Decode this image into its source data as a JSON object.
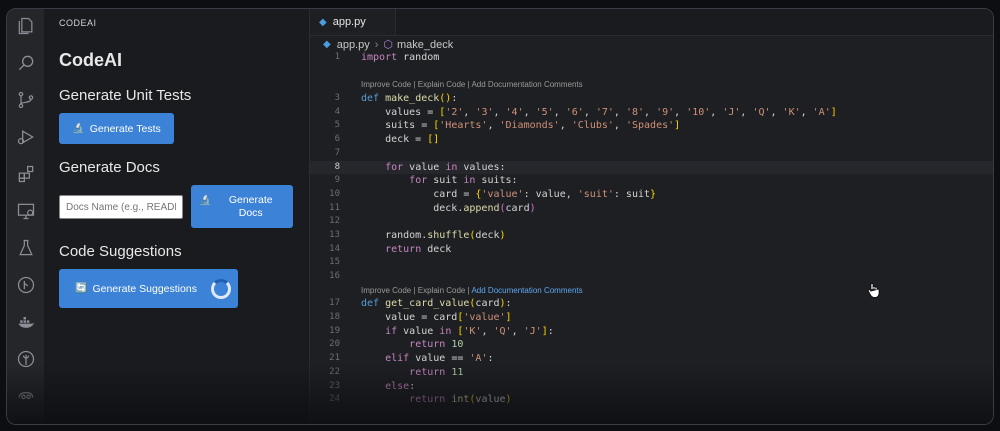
{
  "panel": {
    "title": "CODEAI",
    "heading": "CodeAI",
    "unit_tests_heading": "Generate Unit Tests",
    "generate_tests_label": "Generate Tests",
    "docs_heading": "Generate Docs",
    "docs_placeholder": "Docs Name (e.g., README.md)",
    "generate_docs_label": "Generate Docs",
    "suggestions_heading": "Code Suggestions",
    "generate_suggestions_label": "Generate Suggestions"
  },
  "activity_bar": [
    "explorer-icon",
    "search-icon",
    "source-control-icon",
    "run-debug-icon",
    "extensions-icon",
    "remote-explorer-icon",
    "testing-icon",
    "git-graph-icon",
    "docker-icon",
    "tree-icon",
    "copilot-icon"
  ],
  "editor": {
    "tab_label": "app.py",
    "breadcrumb_file": "app.py",
    "breadcrumb_symbol": "make_deck",
    "codelens": {
      "improve": "Improve Code",
      "explain": "Explain Code",
      "docs": "Add Documentation Comments",
      "sep": " | "
    },
    "line_numbers": [
      "1",
      "2",
      "3",
      "4",
      "5",
      "6",
      "7",
      "8",
      "9",
      "10",
      "11",
      "12",
      "13",
      "14",
      "15",
      "16",
      "17",
      "18",
      "19",
      "20",
      "21",
      "22",
      "23",
      "24"
    ]
  }
}
